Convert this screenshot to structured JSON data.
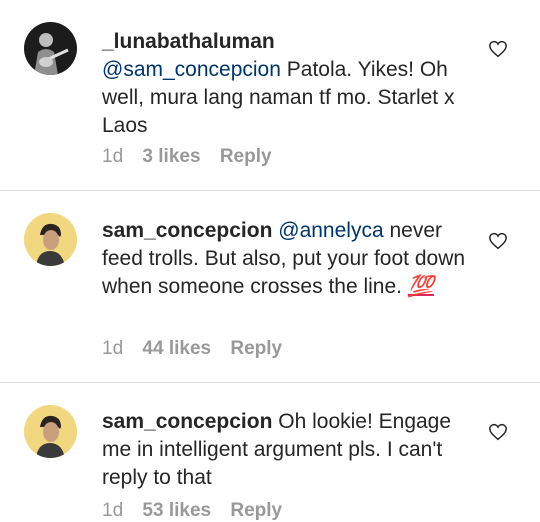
{
  "comments": [
    {
      "username": "_lunabathaluman",
      "mention": "@sam_concepcion",
      "text": "Patola. Yikes! Oh well, mura lang naman tf mo. Starlet x Laos",
      "time": "1d",
      "likes": "3 likes",
      "reply": "Reply",
      "avatar_icon": "avatar-guitar-player-icon"
    },
    {
      "username": "sam_concepcion",
      "mention": "@annelyca",
      "text": "never feed trolls. But also, put your foot down when someone crosses the line.",
      "emoji": "💯",
      "time": "1d",
      "likes": "44 likes",
      "reply": "Reply",
      "avatar_icon": "avatar-man-icon"
    },
    {
      "username": "sam_concepcion",
      "mention": "",
      "text": "Oh lookie! Engage me in intelligent argument pls. I can't reply to that",
      "time": "1d",
      "likes": "53 likes",
      "reply": "Reply",
      "avatar_icon": "avatar-man-icon"
    }
  ],
  "colors": {
    "text": "#262626",
    "mention": "#003569",
    "meta": "#999999",
    "divider": "#dbdbdb",
    "emoji": "#e0245e"
  }
}
